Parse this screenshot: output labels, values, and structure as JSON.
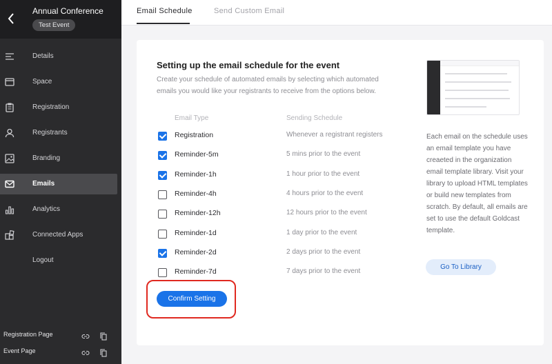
{
  "sidebar": {
    "event_title": "Annual Conference",
    "event_badge": "Test Event",
    "items": [
      {
        "label": "Details",
        "icon": "details-icon"
      },
      {
        "label": "Space",
        "icon": "window-icon"
      },
      {
        "label": "Registration",
        "icon": "clipboard-icon"
      },
      {
        "label": "Registrants",
        "icon": "person-icon"
      },
      {
        "label": "Branding",
        "icon": "image-icon"
      },
      {
        "label": "Emails",
        "icon": "envelope-icon",
        "active": true
      },
      {
        "label": "Analytics",
        "icon": "bar-chart-icon"
      },
      {
        "label": "Connected Apps",
        "icon": "apps-icon"
      },
      {
        "label": "Logout",
        "icon": ""
      }
    ],
    "footer": [
      {
        "label": "Registration Page"
      },
      {
        "label": "Event Page"
      }
    ]
  },
  "tabs": [
    {
      "label": "Email Schedule",
      "active": true
    },
    {
      "label": "Send Custom Email",
      "active": false
    }
  ],
  "schedule": {
    "title": "Setting up the email schedule for the event",
    "description": "Create your schedule of automated emails by selecting which automated emails you would like your registrants to receive from the options below.",
    "col_type": "Email Type",
    "col_schedule": "Sending Schedule",
    "rows": [
      {
        "type": "Registration",
        "schedule": "Whenever a registrant registers",
        "checked": true
      },
      {
        "type": "Reminder-5m",
        "schedule": "5 mins prior to the event",
        "checked": true
      },
      {
        "type": "Reminder-1h",
        "schedule": "1 hour prior to the event",
        "checked": true
      },
      {
        "type": "Reminder-4h",
        "schedule": "4 hours prior to the event",
        "checked": false
      },
      {
        "type": "Reminder-12h",
        "schedule": "12 hours prior to the event",
        "checked": false
      },
      {
        "type": "Reminder-1d",
        "schedule": "1 day prior to the event",
        "checked": false
      },
      {
        "type": "Reminder-2d",
        "schedule": "2 days prior to the event",
        "checked": true
      },
      {
        "type": "Reminder-7d",
        "schedule": "7 days prior to the event",
        "checked": false
      }
    ],
    "confirm_label": "Confirm Setting"
  },
  "info": {
    "text": "Each email on the schedule uses an email template you have creaeted in the organization email template library. Visit your library to upload HTML templates or build new templates from scratch. By default, all emails are set to use the default Goldcast template.",
    "library_label": "Go To Library"
  },
  "colors": {
    "accent": "#1a73e8",
    "sidebar_bg": "#2b2b2d",
    "highlight": "#e0281f"
  }
}
